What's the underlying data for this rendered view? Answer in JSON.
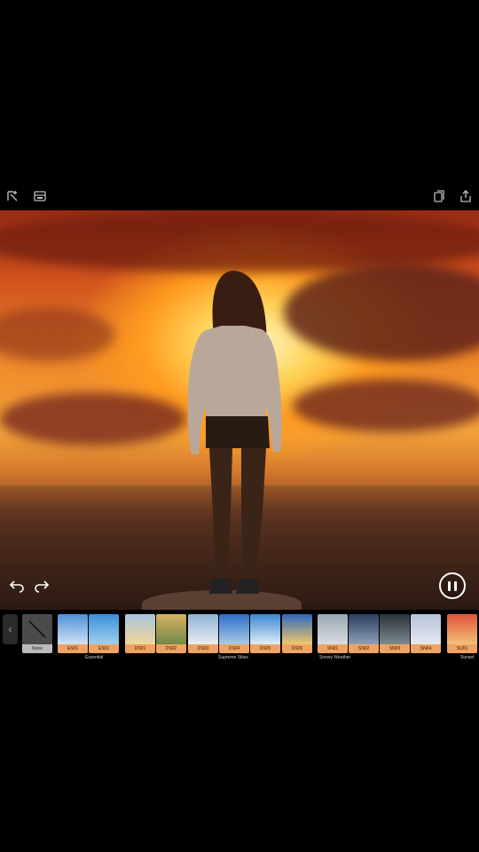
{
  "toolbar": {
    "left_icons": [
      "crop-magic-icon",
      "image-icon"
    ],
    "right_icons": [
      "layers-icon",
      "share-icon"
    ]
  },
  "player": {
    "undo_icon": "undo-arrow-icon",
    "redo_icon": "redo-arrow-icon",
    "pause_icon": "pause-icon"
  },
  "sky_strip": {
    "none_label": "None",
    "thumbnails": [
      {
        "label": "ES01",
        "colors": [
          "#4f8fd8",
          "#cfe3f6"
        ]
      },
      {
        "label": "ES02",
        "colors": [
          "#3a8fd6",
          "#9fd0f0"
        ]
      },
      {
        "label": "DS01",
        "colors": [
          "#a8c4dd",
          "#f1d79a"
        ]
      },
      {
        "label": "DS02",
        "colors": [
          "#d8b060",
          "#6f8a4a"
        ]
      },
      {
        "label": "DS03",
        "colors": [
          "#8fb3d3",
          "#e8eef2"
        ]
      },
      {
        "label": "DS04",
        "colors": [
          "#2d6cc6",
          "#a9cbe8"
        ]
      },
      {
        "label": "DS05",
        "colors": [
          "#3c86d2",
          "#dfeef8"
        ]
      },
      {
        "label": "DS06",
        "colors": [
          "#2e66c0",
          "#f0c86a"
        ]
      },
      {
        "label": "SN01",
        "colors": [
          "#9aa8b3",
          "#d8dde1"
        ]
      },
      {
        "label": "SN02",
        "colors": [
          "#2c3d5e",
          "#8e9fb8"
        ]
      },
      {
        "label": "SN03",
        "colors": [
          "#2a3238",
          "#7d8a92"
        ]
      },
      {
        "label": "SN04",
        "colors": [
          "#b8c2d8",
          "#e4e8f2"
        ]
      },
      {
        "label": "SU01",
        "colors": [
          "#e0543a",
          "#f4c07a"
        ]
      }
    ],
    "groups": [
      "Essential",
      "Supreme Skies",
      "Snowy Weather",
      "Sunset"
    ]
  }
}
